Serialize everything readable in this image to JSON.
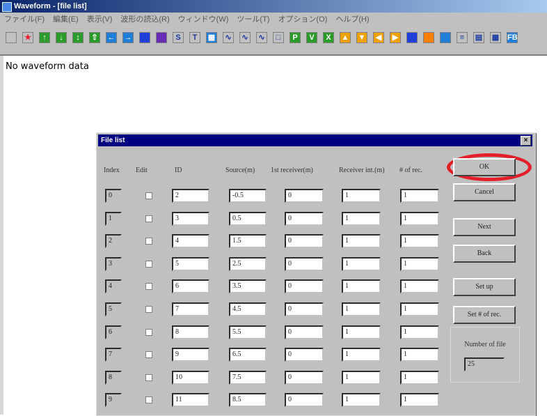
{
  "window": {
    "title": "Waveform - [file list]"
  },
  "menu": [
    "ファイル(F)",
    "編集(E)",
    "表示(V)",
    "波形の読込(R)",
    "ウィンドウ(W)",
    "ツール(T)",
    "オプション(O)",
    "ヘルプ(H)"
  ],
  "toolbar": [
    {
      "icon": "new-icon",
      "color": "#c0c0c0",
      "glyph": ""
    },
    {
      "icon": "star-icon",
      "color": "#c0c0c0",
      "glyph": "★"
    },
    {
      "icon": "arrow-up-icon",
      "color": "#2a9a2a",
      "glyph": "↑"
    },
    {
      "icon": "arrow-down-icon",
      "color": "#2a9a2a",
      "glyph": "↓"
    },
    {
      "icon": "arrow-updown-icon",
      "color": "#2a9a2a",
      "glyph": "↕"
    },
    {
      "icon": "arrow-up2-icon",
      "color": "#2a9a2a",
      "glyph": "⇧"
    },
    {
      "icon": "arrow-left-icon",
      "color": "#1f7fd8",
      "glyph": "←"
    },
    {
      "icon": "arrow-right-icon",
      "color": "#1f7fd8",
      "glyph": "→"
    },
    {
      "icon": "blue-block-icon",
      "color": "#1f3fd8",
      "glyph": ""
    },
    {
      "icon": "purple-block-icon",
      "color": "#6a2ab8",
      "glyph": ""
    },
    {
      "icon": "s-icon",
      "color": "#c0c0c0",
      "glyph": "S"
    },
    {
      "icon": "t-icon",
      "color": "#c0c0c0",
      "glyph": "T"
    },
    {
      "icon": "grid-icon",
      "color": "#1f7fd8",
      "glyph": "▦"
    },
    {
      "icon": "wave-icon",
      "color": "#c0c0c0",
      "glyph": "∿"
    },
    {
      "icon": "wave-marker-icon",
      "color": "#c0c0c0",
      "glyph": "∿"
    },
    {
      "icon": "wave-alt-icon",
      "color": "#c0c0c0",
      "glyph": "∿"
    },
    {
      "icon": "page-icon",
      "color": "#c0c0c0",
      "glyph": "□"
    },
    {
      "icon": "p-icon",
      "color": "#2a9a2a",
      "glyph": "P"
    },
    {
      "icon": "v-icon",
      "color": "#2a9a2a",
      "glyph": "V"
    },
    {
      "icon": "x-icon",
      "color": "#2a9a2a",
      "glyph": "X"
    },
    {
      "icon": "triangle-up-icon",
      "color": "#f0a000",
      "glyph": "▲"
    },
    {
      "icon": "triangle-down-icon",
      "color": "#f0a000",
      "glyph": "▼"
    },
    {
      "icon": "triangle-left-icon",
      "color": "#f0a000",
      "glyph": "◀"
    },
    {
      "icon": "triangle-right-icon",
      "color": "#f0a000",
      "glyph": "▶"
    },
    {
      "icon": "color-bars-icon",
      "color": "#1f3fd8",
      "glyph": ""
    },
    {
      "icon": "rainbow-icon",
      "color": "#ff8000",
      "glyph": ""
    },
    {
      "icon": "stripes-icon",
      "color": "#1f7fd8",
      "glyph": ""
    },
    {
      "icon": "lines-icon",
      "color": "#c0c0c0",
      "glyph": "≡"
    },
    {
      "icon": "table-icon",
      "color": "#c0c0c0",
      "glyph": "▤"
    },
    {
      "icon": "grid2-icon",
      "color": "#c0c0c0",
      "glyph": "▦"
    },
    {
      "icon": "fb-icon",
      "color": "#1f7fd8",
      "glyph": "FB"
    }
  ],
  "main": {
    "message": "No waveform data"
  },
  "dialog": {
    "title": "File list",
    "close": "×",
    "headers": [
      "Index",
      "Edit",
      "ID",
      "Source(m)",
      "1st receiver(m)",
      "Receiver int.(m)",
      "# of rec."
    ],
    "rows": [
      {
        "index": "0",
        "id": "2",
        "source": "-0.5",
        "first": "0",
        "interval": "1",
        "count": "1"
      },
      {
        "index": "1",
        "id": "3",
        "source": "0.5",
        "first": "0",
        "interval": "1",
        "count": "1"
      },
      {
        "index": "2",
        "id": "4",
        "source": "1.5",
        "first": "0",
        "interval": "1",
        "count": "1"
      },
      {
        "index": "3",
        "id": "5",
        "source": "2.5",
        "first": "0",
        "interval": "1",
        "count": "1"
      },
      {
        "index": "4",
        "id": "6",
        "source": "3.5",
        "first": "0",
        "interval": "1",
        "count": "1"
      },
      {
        "index": "5",
        "id": "7",
        "source": "4.5",
        "first": "0",
        "interval": "1",
        "count": "1"
      },
      {
        "index": "6",
        "id": "8",
        "source": "5.5",
        "first": "0",
        "interval": "1",
        "count": "1"
      },
      {
        "index": "7",
        "id": "9",
        "source": "6.5",
        "first": "0",
        "interval": "1",
        "count": "1"
      },
      {
        "index": "8",
        "id": "10",
        "source": "7.5",
        "first": "0",
        "interval": "1",
        "count": "1"
      },
      {
        "index": "9",
        "id": "11",
        "source": "8.5",
        "first": "0",
        "interval": "1",
        "count": "1"
      }
    ],
    "buttons": {
      "ok": "OK",
      "cancel": "Cancel",
      "next": "Next",
      "back": "Back",
      "setup": "Set up",
      "set_count": "Set # of rec."
    },
    "number_of_file": {
      "label": "Number of file",
      "value": "25"
    }
  },
  "annotation_color": "#e41f2a"
}
